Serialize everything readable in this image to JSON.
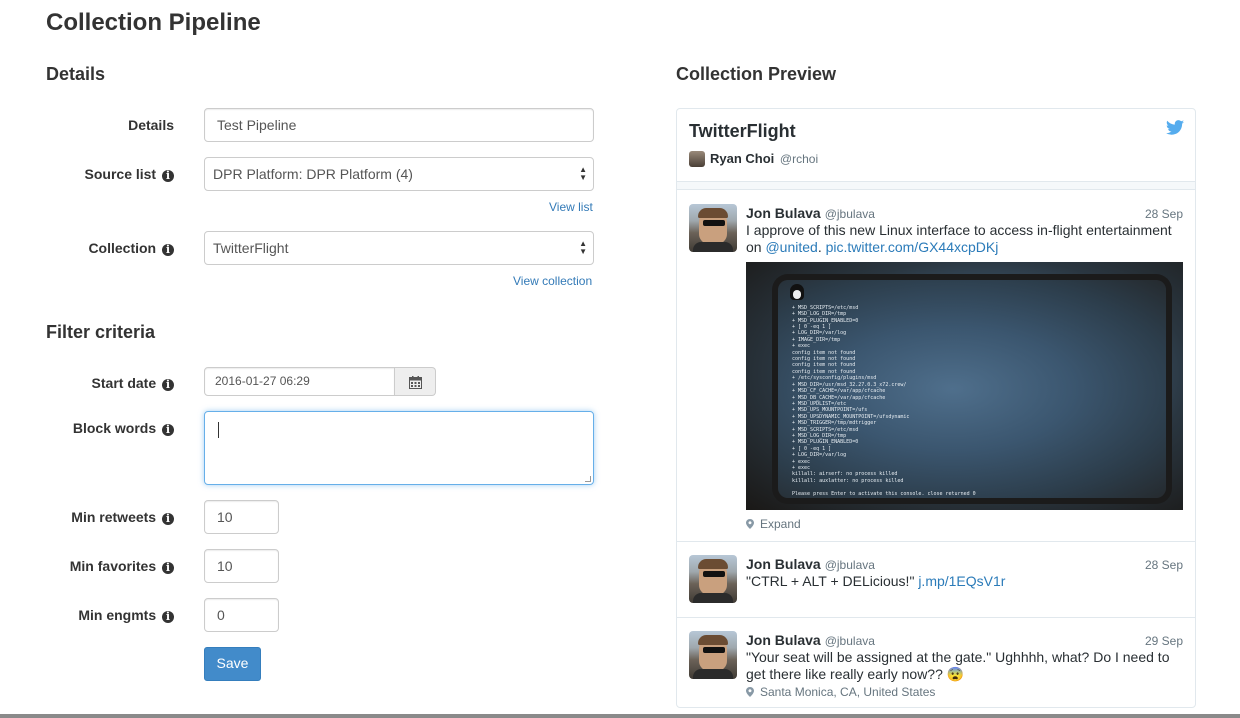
{
  "page": {
    "title": "Collection Pipeline"
  },
  "details_section": {
    "heading": "Details"
  },
  "form": {
    "details": {
      "label": "Details",
      "value": "Test Pipeline"
    },
    "source_list": {
      "label": "Source list",
      "value": "DPR Platform: DPR Platform (4)",
      "link": "View list"
    },
    "collection": {
      "label": "Collection",
      "value": "TwitterFlight",
      "link": "View collection"
    }
  },
  "filter_section": {
    "heading": "Filter criteria"
  },
  "filters": {
    "start_date": {
      "label": "Start date",
      "value": "2016-01-27 06:29"
    },
    "block_words": {
      "label": "Block words",
      "value": ""
    },
    "min_retweets": {
      "label": "Min retweets",
      "value": "10"
    },
    "min_favorites": {
      "label": "Min favorites",
      "value": "10"
    },
    "min_engmts": {
      "label": "Min engmts",
      "value": "0"
    },
    "save_label": "Save"
  },
  "preview": {
    "heading": "Collection Preview",
    "widget_title": "TwitterFlight",
    "owner_name": "Ryan Choi",
    "owner_handle": "@rchoi",
    "tweets": [
      {
        "name": "Jon Bulava",
        "handle": "@jbulava",
        "date": "28 Sep",
        "text": "I approve of this new Linux interface to access in-flight entertainment on ",
        "mention": "@united",
        "sep": ". ",
        "link": "pic.twitter.com/GX44xcpDKj",
        "meta": "Expand"
      },
      {
        "name": "Jon Bulava",
        "handle": "@jbulava",
        "date": "28 Sep",
        "text": "\"CTRL + ALT + DELicious!\" ",
        "link": "j.mp/1EQsV1r"
      },
      {
        "name": "Jon Bulava",
        "handle": "@jbulava",
        "date": "29 Sep",
        "text": "\"Your seat will be assigned at the gate.\" Ughhhh, what? Do I need to get there like really early now?? 😨",
        "meta": "Santa Monica, CA, United States"
      }
    ]
  },
  "colors": {
    "accent": "#428bca",
    "link": "#337ab7",
    "twitter": "#55acee"
  },
  "icons": [
    "info-icon",
    "calendar-icon",
    "twitter-bird-icon",
    "location-pin-icon"
  ]
}
